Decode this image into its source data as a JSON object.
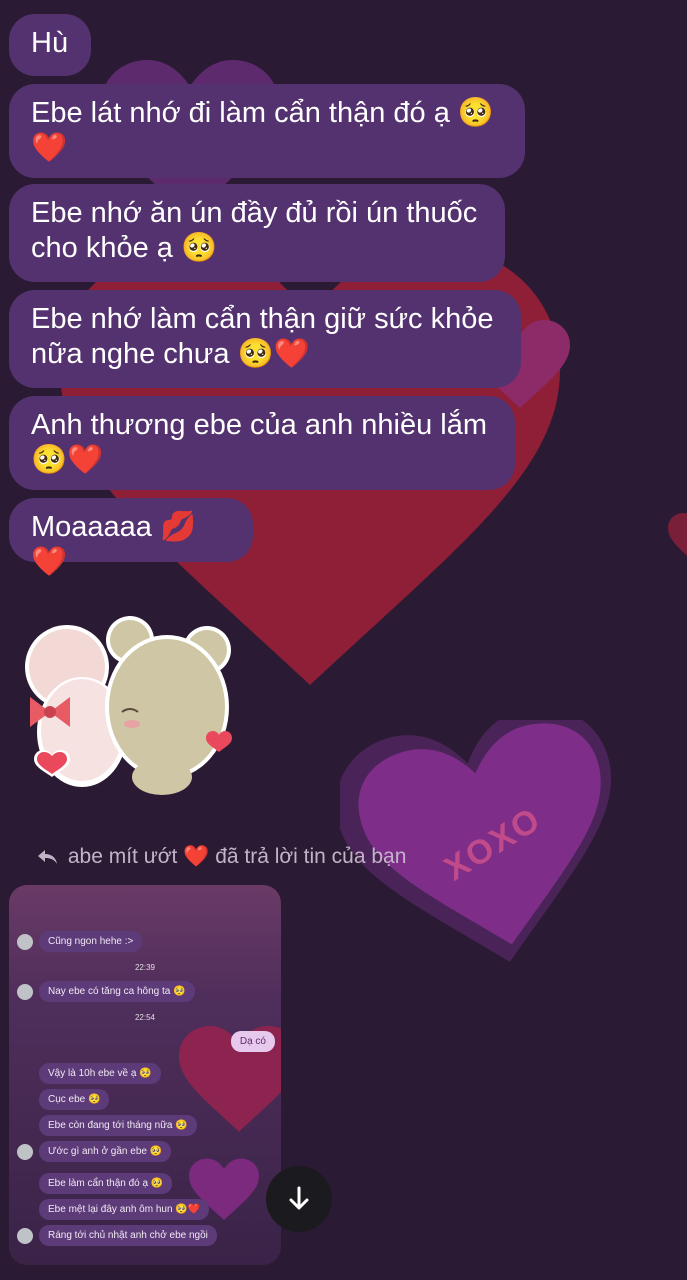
{
  "messages": [
    {
      "line1": "Hù",
      "line2": ""
    },
    {
      "line1": "Ebe lát nhớ đi làm cẩn thận đó ạ 🥺",
      "line2": "❤️"
    },
    {
      "line1": "Ebe nhớ ăn ún đầy đủ rồi ún thuốc",
      "line2": "cho khỏe ạ 🥺"
    },
    {
      "line1": "Ebe nhớ làm cẩn thận giữ sức khỏe",
      "line2": "nữa nghe chưa 🥺❤️"
    },
    {
      "line1": "Anh thương ebe của anh nhiều lắm",
      "line2": "🥺❤️"
    },
    {
      "line1": "Moaaaaa 💋❤️",
      "line2": ""
    }
  ],
  "reply_note": {
    "icon": "reply-arrow-icon",
    "text": "abe mít ướt ❤️ đã trả lời tin của bạn"
  },
  "heart_text": "XOXO",
  "quoted_screenshot": {
    "messages": [
      {
        "text": "Cũng ngon hehe :>",
        "avatar": true
      },
      {
        "time": "22:39"
      },
      {
        "text": "Nay ebe có tăng ca hông ta 🥺",
        "avatar": true
      },
      {
        "time": "22:54"
      },
      {
        "mine": "Dạ có"
      },
      {
        "text": "Vậy là 10h ebe về ạ 🥺",
        "avatar": false
      },
      {
        "text": "Cục ebe 🥺",
        "avatar": false
      },
      {
        "text": "Ebe còn đang tới tháng nữa 🥺",
        "avatar": false
      },
      {
        "text": "Ước gì anh ở gần ebe 🥺",
        "avatar": true
      },
      {
        "text": "Ebe làm cẩn thận đó ạ 🥺",
        "avatar": false
      },
      {
        "text": "Ebe mệt lại đây anh ôm hun 🥺❤️",
        "avatar": false
      },
      {
        "text": "Ráng tới chủ nhật anh chở ebe ngồi",
        "avatar": true
      }
    ]
  },
  "scroll_button_icon": "arrow-down-icon",
  "colors": {
    "bubble": "#54326f",
    "background": "#2b1a33",
    "heart_red": "#8f1f37",
    "heart_purple": "#7e2e88"
  }
}
